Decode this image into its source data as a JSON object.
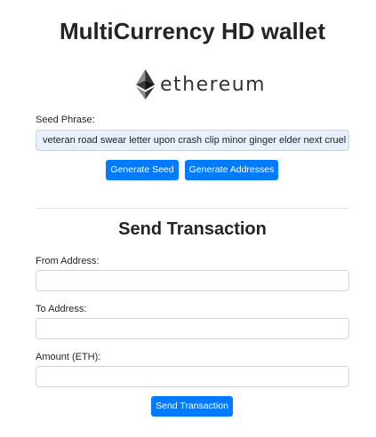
{
  "header": {
    "title": "MultiCurrency HD wallet",
    "logo_text": "ethereum",
    "logo_icon": "ethereum-diamond-icon"
  },
  "seed": {
    "label": "Seed Phrase:",
    "value": "veteran road swear letter upon crash clip minor ginger elder next cruel"
  },
  "actions": {
    "generate_seed": "Generate Seed",
    "generate_addresses": "Generate Addresses"
  },
  "transaction": {
    "title": "Send Transaction",
    "from_label": "From Address:",
    "from_value": "",
    "to_label": "To Address:",
    "to_value": "",
    "amount_label": "Amount (ETH):",
    "amount_value": "",
    "send_button": "Send Transaction"
  },
  "colors": {
    "primary": "#007bff",
    "seed_field_bg": "#e8f0fe",
    "text": "#212529"
  }
}
